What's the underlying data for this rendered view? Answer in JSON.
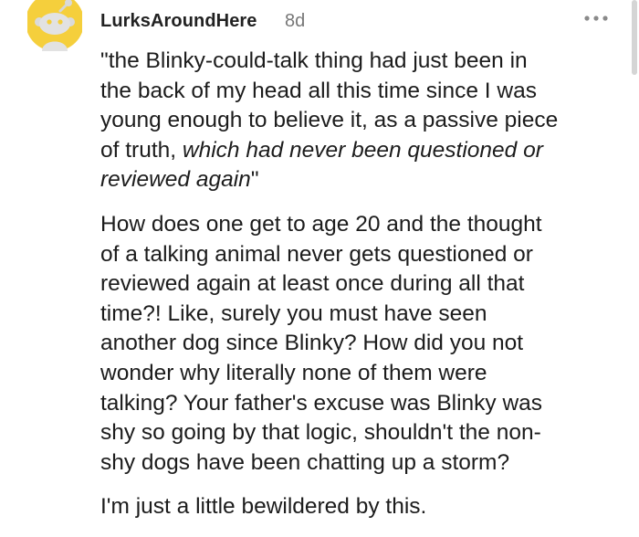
{
  "comment": {
    "username": "LurksAroundHere",
    "age": "8d",
    "avatar_icon": "reddit-snoo-avatar-icon",
    "more_icon": "more-options-icon",
    "quote": {
      "open": "\"the Blinky-could-talk thing had just been in\nthe back of my head all this time since I was\nyoung enough to believe it, as a passive piece\nof truth, ",
      "italic": "which had never been questioned or\nreviewed again",
      "close": "\""
    },
    "paragraph_2": "How does one get to age 20 and the thought\nof a talking animal never gets questioned or\nreviewed again at least once during all that\ntime?! Like, surely you must have seen\nanother dog since Blinky? How did you not\nwonder why literally none of them were\ntalking? Your father's excuse was Blinky was\nshy so going by that logic, shouldn't the non-\nshy dogs have been chatting up a storm?",
    "paragraph_3": "I'm just a little bewildered by this."
  },
  "colors": {
    "avatar_bg": "#F5CF3C",
    "text": "#1c1c1c",
    "meta": "#777777"
  }
}
